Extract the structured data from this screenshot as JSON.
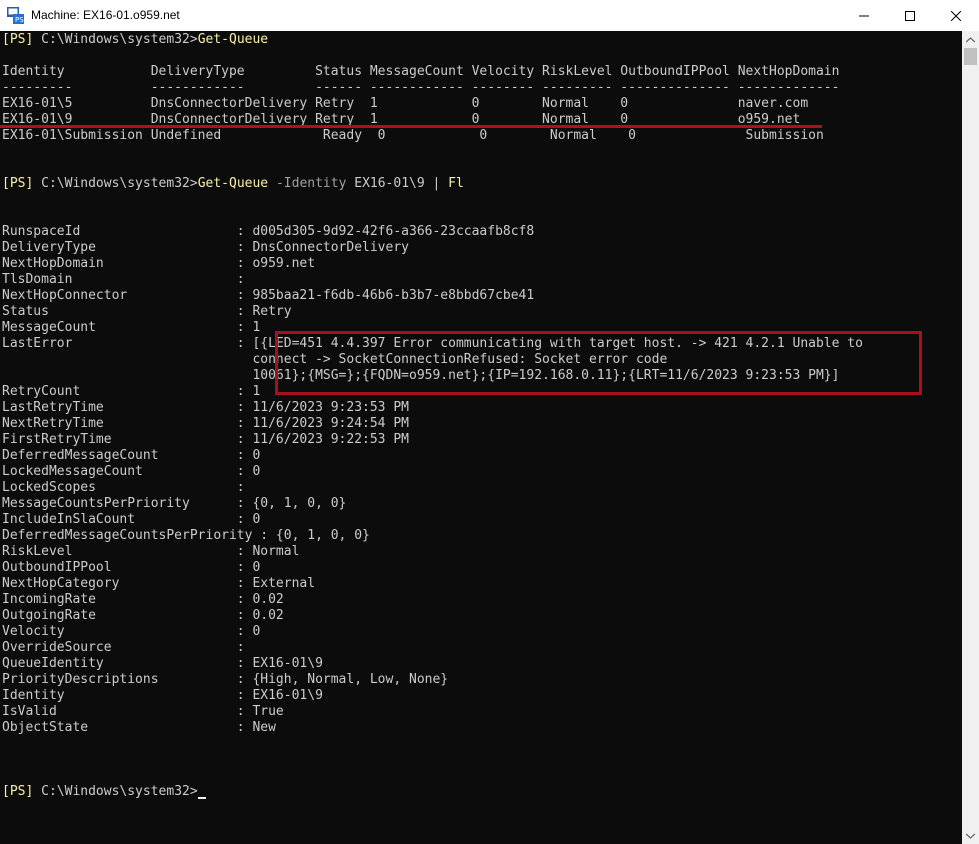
{
  "window": {
    "title": "Machine: EX16-01.o959.net",
    "minimize_icon": "minimize-icon",
    "maximize_icon": "maximize-icon",
    "close_icon": "close-icon"
  },
  "prompt1": {
    "tag": "[PS]",
    "path": " C:\\Windows\\system32>",
    "cmd": "Get-Queue"
  },
  "queue_table": {
    "header": "Identity           DeliveryType         Status MessageCount Velocity RiskLevel OutboundIPPool NextHopDomain",
    "dashes": "---------          ------------         ------ ------------ -------- --------- -------------- -------------",
    "rows": [
      "EX16-01\\5          DnsConnectorDelivery Retry  1            0        Normal    0              naver.com",
      "EX16-01\\9          DnsConnectorDelivery Retry  1            0        Normal    0              o959.net",
      "EX16-01\\Submission Undefined             Ready  0            0        Normal    0              Submission"
    ]
  },
  "prompt2": {
    "tag": "[PS]",
    "path": " C:\\Windows\\system32>",
    "cmd": "Get-Queue",
    "param": " -Identity",
    "arg": " EX16-01\\9 ",
    "pipe": "|",
    "fl": " Fl"
  },
  "details": [
    "RunspaceId                    : d005d305-9d92-42f6-a366-23ccaafb8cf8",
    "DeliveryType                  : DnsConnectorDelivery",
    "NextHopDomain                 : o959.net",
    "TlsDomain                     :",
    "NextHopConnector              : 985baa21-f6db-46b6-b3b7-e8bbd67cbe41",
    "Status                        : Retry",
    "MessageCount                  : 1",
    "LastError                     : [{LED=451 4.4.397 Error communicating with target host. -> 421 4.2.1 Unable to",
    "                                connect -> SocketConnectionRefused: Socket error code",
    "                                10061};{MSG=};{FQDN=o959.net};{IP=192.168.0.11};{LRT=11/6/2023 9:23:53 PM}]",
    "RetryCount                    : 1",
    "LastRetryTime                 : 11/6/2023 9:23:53 PM",
    "NextRetryTime                 : 11/6/2023 9:24:54 PM",
    "FirstRetryTime                : 11/6/2023 9:22:53 PM",
    "DeferredMessageCount          : 0",
    "LockedMessageCount            : 0",
    "LockedScopes                  :",
    "MessageCountsPerPriority      : {0, 1, 0, 0}",
    "IncludeInSlaCount             : 0",
    "DeferredMessageCountsPerPriority : {0, 1, 0, 0}",
    "RiskLevel                     : Normal",
    "OutboundIPPool                : 0",
    "NextHopCategory               : External",
    "IncomingRate                  : 0.02",
    "OutgoingRate                  : 0.02",
    "Velocity                      : 0",
    "OverrideSource                :",
    "QueueIdentity                 : EX16-01\\9",
    "PriorityDescriptions          : {High, Normal, Low, None}",
    "Identity                      : EX16-01\\9",
    "IsValid                       : True",
    "ObjectState                   : New"
  ],
  "prompt3": {
    "tag": "[PS]",
    "path": " C:\\Windows\\system32>"
  },
  "colors": {
    "terminal_bg": "#0c0c0c",
    "text": "#cccccc",
    "prompt": "#f9f1a5",
    "highlight": "#a8101c"
  }
}
